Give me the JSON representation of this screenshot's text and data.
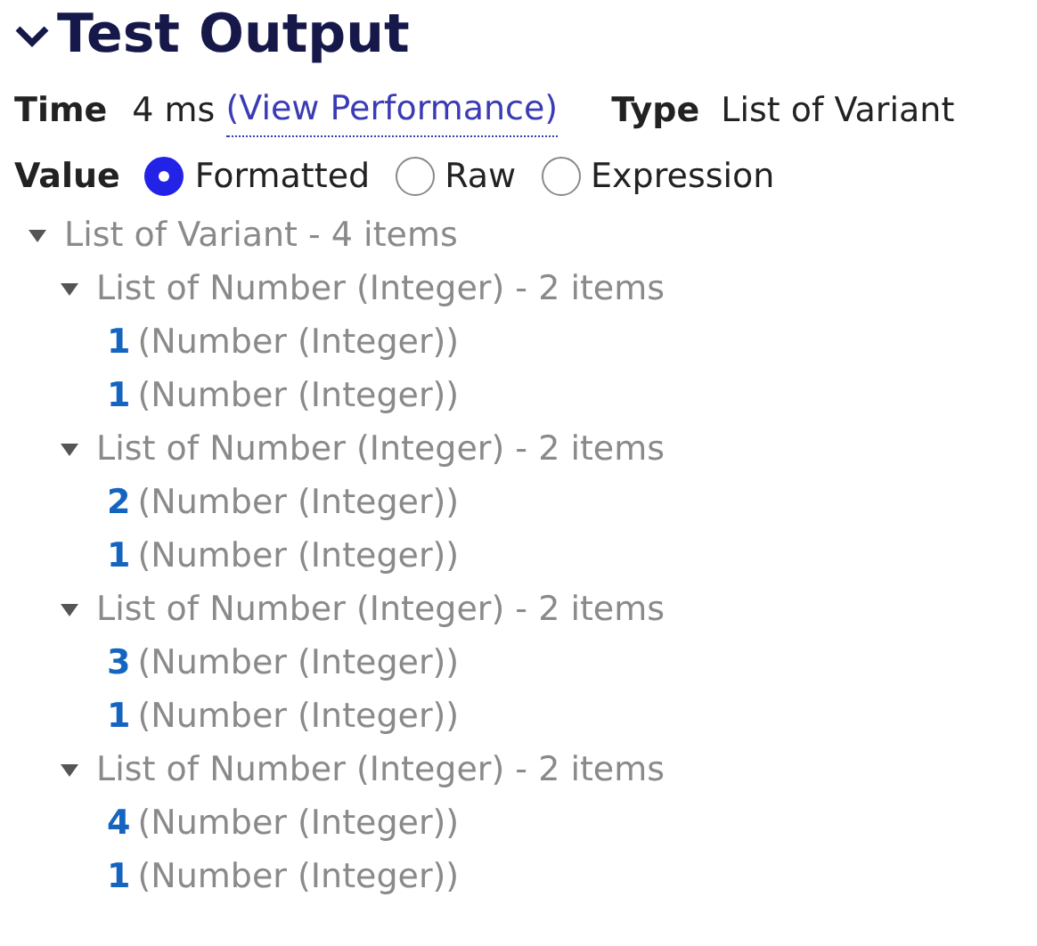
{
  "panel": {
    "title": "Test Output",
    "expanded": true
  },
  "meta": [
    {
      "label": "Time",
      "value": "4 ms",
      "link": "(View Performance)"
    },
    {
      "label": "Type",
      "value": "List of Variant"
    }
  ],
  "value_view": {
    "label": "Value",
    "options": [
      {
        "label": "Formatted",
        "selected": true
      },
      {
        "label": "Raw",
        "selected": false
      },
      {
        "label": "Expression",
        "selected": false
      }
    ]
  },
  "tree": [
    {
      "label": "List of Variant - 4 items",
      "expanded": true,
      "children": [
        {
          "label": "List of Number (Integer) - 2 items",
          "expanded": true,
          "children": [
            {
              "value": "1",
              "type": "(Number (Integer))"
            },
            {
              "value": "1",
              "type": "(Number (Integer))"
            }
          ]
        },
        {
          "label": "List of Number (Integer) - 2 items",
          "expanded": true,
          "children": [
            {
              "value": "2",
              "type": "(Number (Integer))"
            },
            {
              "value": "1",
              "type": "(Number (Integer))"
            }
          ]
        },
        {
          "label": "List of Number (Integer) - 2 items",
          "expanded": true,
          "children": [
            {
              "value": "3",
              "type": "(Number (Integer))"
            },
            {
              "value": "1",
              "type": "(Number (Integer))"
            }
          ]
        },
        {
          "label": "List of Number (Integer) - 2 items",
          "expanded": true,
          "children": [
            {
              "value": "4",
              "type": "(Number (Integer))"
            },
            {
              "value": "1",
              "type": "(Number (Integer))"
            }
          ]
        }
      ]
    }
  ]
}
